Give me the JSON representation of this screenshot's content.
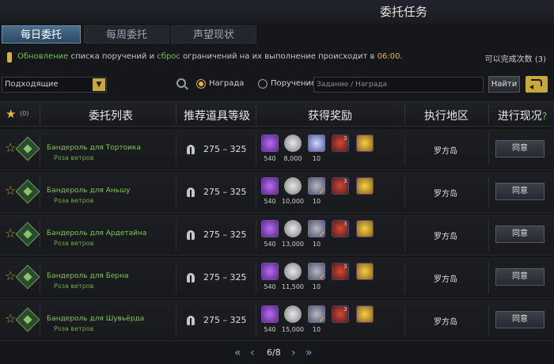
{
  "window": {
    "title": "委托任务"
  },
  "tabs": [
    {
      "label": "每日委托",
      "active": true
    },
    {
      "label": "每周委托",
      "active": false
    },
    {
      "label": "声望现状",
      "active": false
    }
  ],
  "notice": {
    "part1": "Обновление",
    "part2": " списка поручений и ",
    "part3": "сброс",
    "part4": " ограничений на их выполнение происходит в ",
    "time": "06:00",
    "end": ".",
    "count_label": "可以完成次数",
    "count_value": "(3)"
  },
  "filter": {
    "select_value": "Подходящие",
    "radio_reward": "Награда",
    "radio_quest": "Поручение",
    "search_placeholder": "Задание / Награда",
    "find_label": "Найти",
    "selected_radio": "Награда"
  },
  "table_header": {
    "fav_count": "(0)",
    "col_list": "委托列表",
    "col_level": "推荐道具等级",
    "col_rewards": "获得奖励",
    "col_region": "执行地区",
    "col_progress": "进行现况",
    "help": "?"
  },
  "rows": [
    {
      "name": "Бандероль для Тортоика",
      "region_small": "Роза ветров",
      "level": "275 – 325",
      "q1": "540",
      "q2": "8,000",
      "q3": "10",
      "crystal_used": false,
      "region": "罗方岛",
      "button": "同意"
    },
    {
      "name": "Бандероль для Аньшу",
      "region_small": "Роза ветров",
      "level": "275 – 325",
      "q1": "540",
      "q2": "10,000",
      "q3": "10",
      "crystal_used": true,
      "region": "罗方岛",
      "button": "同意"
    },
    {
      "name": "Бандероль для Ардетайна",
      "region_small": "Роза ветров",
      "level": "275 – 325",
      "q1": "540",
      "q2": "13,000",
      "q3": "10",
      "crystal_used": true,
      "region": "罗方岛",
      "button": "同意"
    },
    {
      "name": "Бандероль для Берна",
      "region_small": "Роза ветров",
      "level": "275 – 325",
      "q1": "540",
      "q2": "11,500",
      "q3": "10",
      "crystal_used": true,
      "region": "罗方岛",
      "button": "同意"
    },
    {
      "name": "Бандероль для Шувьёрда",
      "region_small": "Роза ветров",
      "level": "275 – 325",
      "q1": "540",
      "q2": "15,000",
      "q3": "10",
      "crystal_used": true,
      "region": "罗方岛",
      "button": "同意"
    }
  ],
  "rewards_badge": "3",
  "pager": {
    "first": "«",
    "prev": "‹",
    "current": "6/8",
    "next": "›",
    "last": "»"
  },
  "colors": {
    "accent_gold": "#e8b83c",
    "quest_green": "#7fc84e",
    "highlight_green": "#74c24a",
    "highlight_yellow": "#e1b84a",
    "tab_active": "#4a6f8c"
  },
  "icons": [
    "star-icon",
    "quest-emblem-icon",
    "helm-icon",
    "gem-icon",
    "silver-coin-icon",
    "crystal-icon",
    "scroll-icon",
    "gold-coin-icon",
    "search-icon",
    "reset-icon"
  ]
}
